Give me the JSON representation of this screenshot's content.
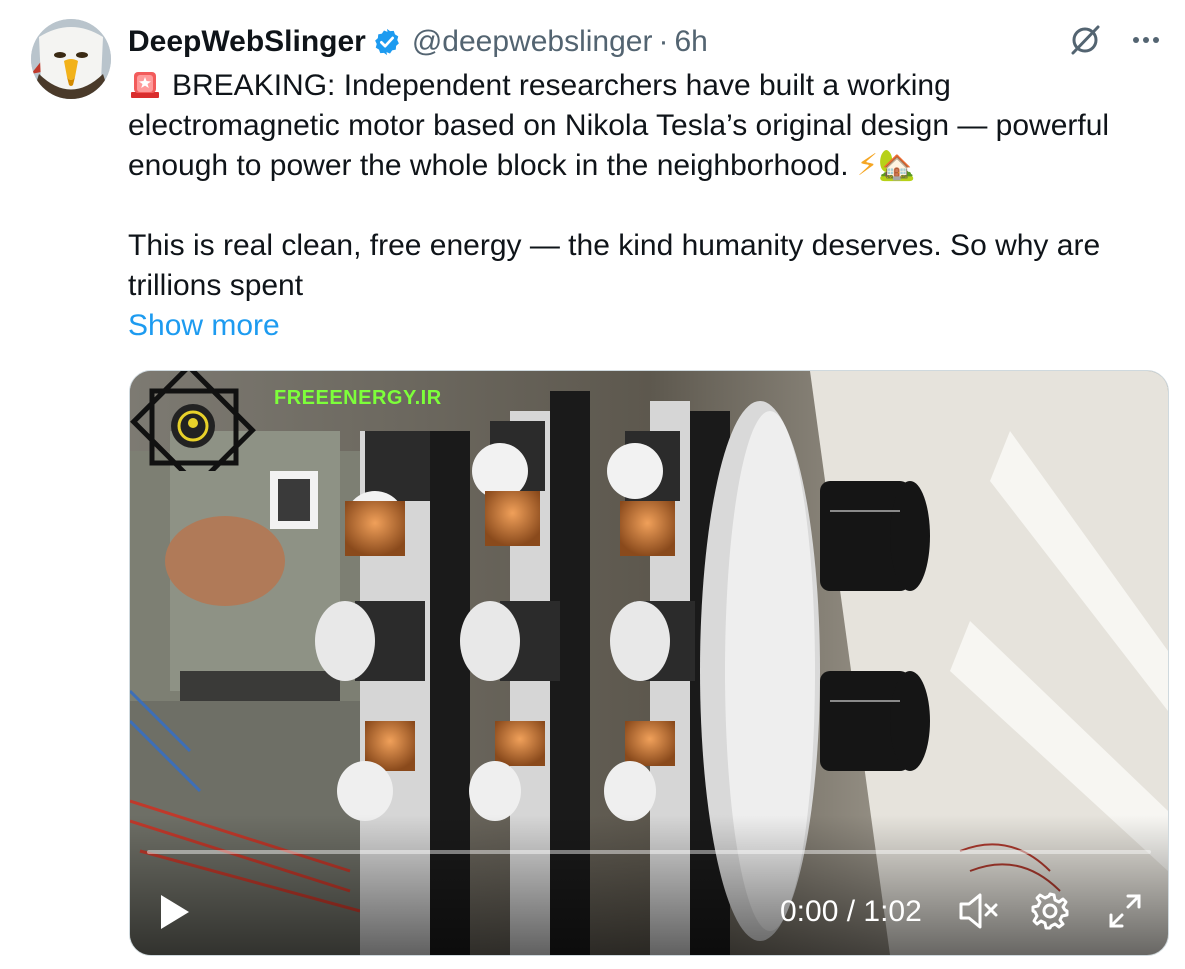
{
  "author": {
    "display_name": "DeepWebSlinger",
    "handle": "@deepwebslinger",
    "separator": "·",
    "time": "6h"
  },
  "icons": {
    "avatar": "bald-eagle-avatar",
    "verified": "verified-badge-icon",
    "grok": "grok-icon",
    "more": "more-options-icon",
    "siren": "police-siren-emoji",
    "bolt": "lightning-emoji",
    "house": "house-garden-emoji"
  },
  "tweet": {
    "line1": "BREAKING: Independent researchers have built a working electromagnetic motor based on Nikola Tesla’s original design — powerful enough to power the whole block in the neighborhood.",
    "bolt_emoji": "⚡",
    "house_emoji": "🏡",
    "line2": "This is real clean, free energy — the kind humanity deserves. So why are trillions spent",
    "show_more": "Show more"
  },
  "video": {
    "watermark": "FREEENERGY.IR",
    "time": "0:00 / 1:02",
    "progress": 0
  },
  "colors": {
    "link": "#1d9bf0",
    "verified": "#1d9bf0",
    "text": "#0f1419",
    "muted": "#536471",
    "watermark": "#7dff3a"
  }
}
